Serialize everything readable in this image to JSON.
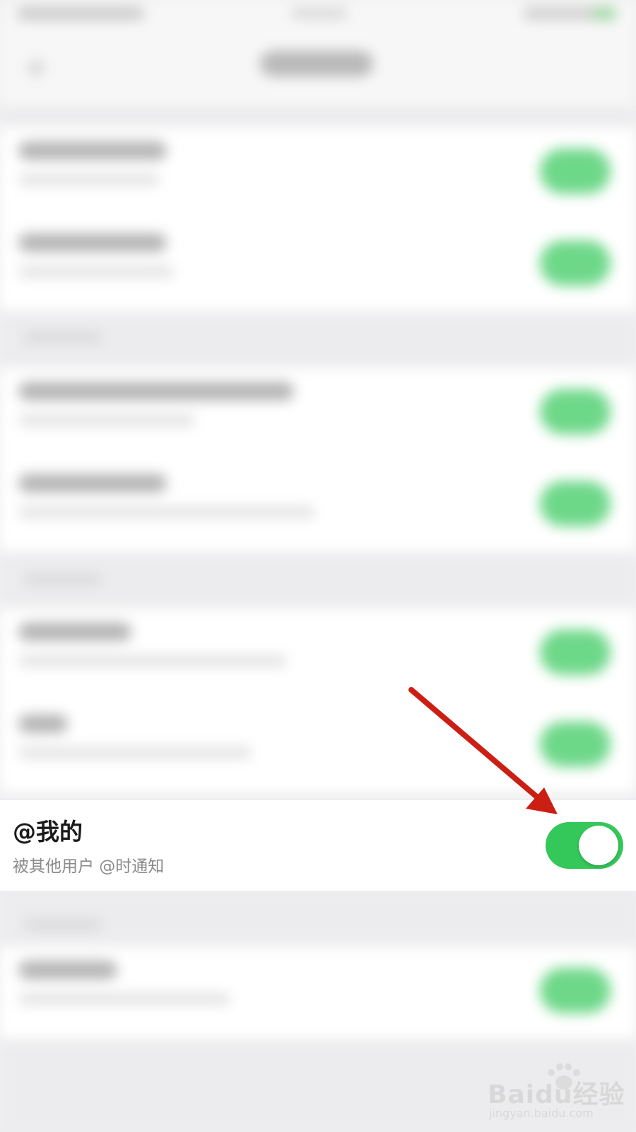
{
  "setting_row": {
    "title": "@我的",
    "subtitle": "被其他用户 @时通知",
    "toggle_on": true
  },
  "colors": {
    "toggle_on": "#34c759",
    "annotation_arrow": "#cc1f14",
    "page_background": "#efeff1"
  },
  "annotation": {
    "type": "arrow",
    "points_to": "toggle"
  },
  "watermark": {
    "brand": "Baidu经验",
    "url": "jingyan.baidu.com"
  }
}
